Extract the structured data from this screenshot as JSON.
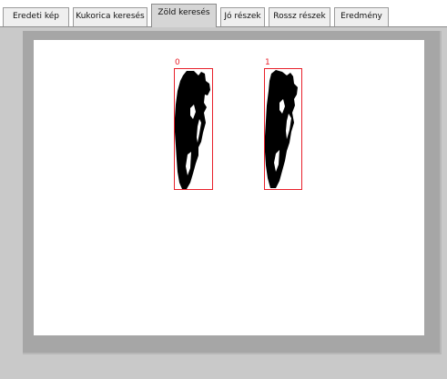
{
  "tabs": [
    {
      "label": "Eredeti kép",
      "active": false
    },
    {
      "label": "Kukorica keresés",
      "active": false
    },
    {
      "label": "Zöld keresés",
      "active": true
    },
    {
      "label": "Jó részek",
      "active": false
    },
    {
      "label": "Rossz részek",
      "active": false
    },
    {
      "label": "Eredmény",
      "active": false
    }
  ],
  "detections": [
    {
      "label": "0"
    },
    {
      "label": "1"
    }
  ],
  "colors": {
    "roi": "#e8202a",
    "blob": "#000000"
  }
}
